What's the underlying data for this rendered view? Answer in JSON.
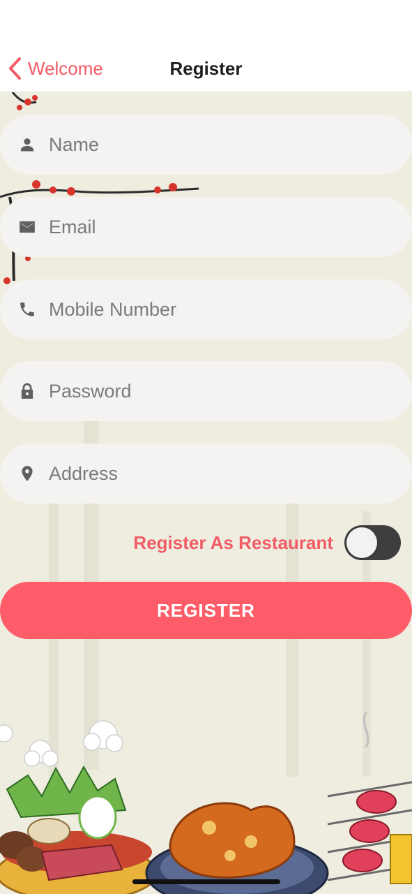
{
  "nav": {
    "back_label": "Welcome",
    "title": "Register"
  },
  "form": {
    "fields": [
      {
        "name": "name",
        "placeholder": "Name",
        "icon": "person-icon",
        "value": ""
      },
      {
        "name": "email",
        "placeholder": "Email",
        "icon": "mail-icon",
        "value": ""
      },
      {
        "name": "mobile",
        "placeholder": "Mobile Number",
        "icon": "phone-icon",
        "value": ""
      },
      {
        "name": "password",
        "placeholder": "Password",
        "icon": "lock-icon",
        "value": ""
      },
      {
        "name": "address",
        "placeholder": "Address",
        "icon": "location-pin-icon",
        "value": ""
      }
    ],
    "toggle_label": "Register As Restaurant",
    "toggle_on": false,
    "submit_label": "REGISTER"
  },
  "colors": {
    "accent": "#f25c66",
    "button": "#fd5c68",
    "field_bg": "#f5f3f1",
    "page_bg": "#eeede0",
    "toggle_track": "#3e3e3e"
  }
}
